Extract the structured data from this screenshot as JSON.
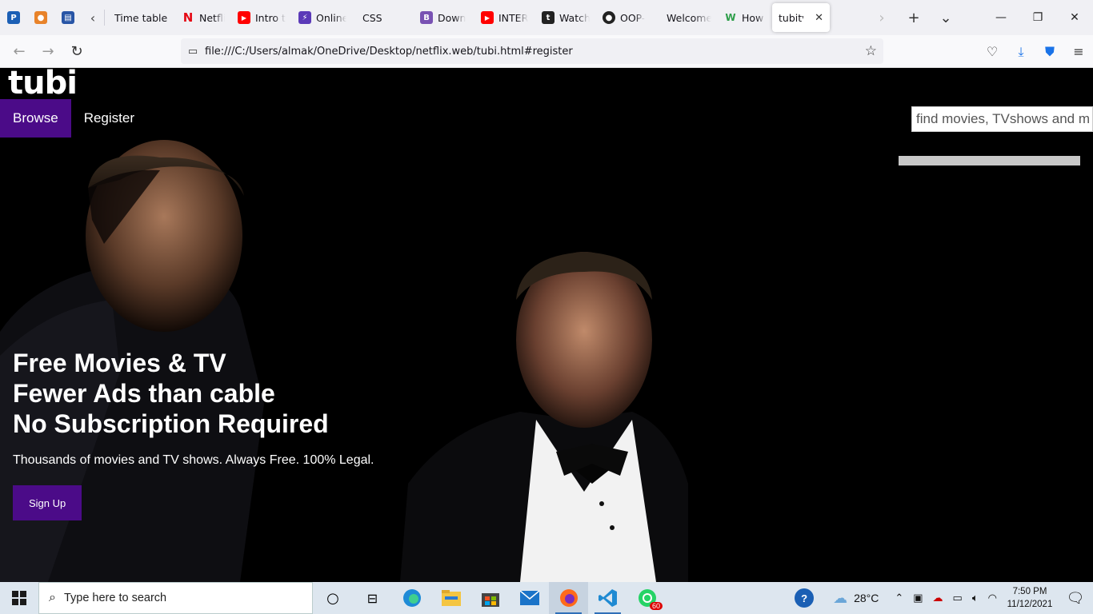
{
  "browser": {
    "pinned_tabs": [
      {
        "icon": "pocket-app-icon",
        "letter": "P",
        "color": "#1b5fb5"
      },
      {
        "icon": "contacts-app-icon",
        "letter": "",
        "color": "#e8832a"
      },
      {
        "icon": "news-site-icon",
        "letter": "",
        "color": "#2855a6"
      }
    ],
    "tabs": [
      {
        "label": "Time table",
        "icon": "",
        "color": ""
      },
      {
        "label": "Netfli",
        "icon": "netflix-icon",
        "color": "#e50914",
        "letter": "N"
      },
      {
        "label": "Intro t",
        "icon": "youtube-icon",
        "color": "#ff0000",
        "letter": "▶"
      },
      {
        "label": "Online",
        "icon": "bolt-icon",
        "color": "#5b3ab8",
        "letter": "⚡"
      },
      {
        "label": "CSS",
        "icon": "",
        "color": ""
      },
      {
        "label": "Down",
        "icon": "bootstrap-icon",
        "color": "#7952b3",
        "letter": "B"
      },
      {
        "label": "INTER",
        "icon": "youtube-icon",
        "color": "#ff0000",
        "letter": "▶"
      },
      {
        "label": "Watch",
        "icon": "tumblr-icon",
        "color": "#222",
        "letter": "t"
      },
      {
        "label": "OOP-",
        "icon": "github-icon",
        "color": "#222",
        "letter": "●"
      },
      {
        "label": "Welcome",
        "icon": "",
        "color": ""
      },
      {
        "label": "How T",
        "icon": "wikihow-icon",
        "color": "#2e9e4a",
        "letter": "W"
      },
      {
        "label": "tubitv",
        "icon": "",
        "color": "",
        "active": true
      }
    ],
    "url": "file:///C:/Users/almak/OneDrive/Desktop/netflix.web/tubi.html#register"
  },
  "site": {
    "logo": "tubi",
    "nav": [
      {
        "label": "Browse",
        "active": true
      },
      {
        "label": "Register",
        "active": false
      }
    ],
    "search_placeholder": "find movies, TVshows and m",
    "hero": {
      "line1": "Free Movies & TV",
      "line2": "Fewer Ads than cable",
      "line3": "No Subscription Required",
      "subtitle": "Thousands of movies and TV shows. Always Free. 100% Legal.",
      "cta": "Sign Up"
    }
  },
  "taskbar": {
    "search_placeholder": "Type here to search",
    "apps": [
      {
        "icon": "cortana-icon"
      },
      {
        "icon": "task-view-icon"
      },
      {
        "icon": "edge-icon"
      },
      {
        "icon": "file-explorer-icon"
      },
      {
        "icon": "store-icon"
      },
      {
        "icon": "mail-icon"
      },
      {
        "icon": "firefox-icon",
        "active": true
      },
      {
        "icon": "vscode-icon",
        "active": true
      },
      {
        "icon": "whatsapp-icon",
        "badge": "60"
      }
    ],
    "weather": "28°C",
    "time": "7:50 PM",
    "date": "11/12/2021"
  }
}
